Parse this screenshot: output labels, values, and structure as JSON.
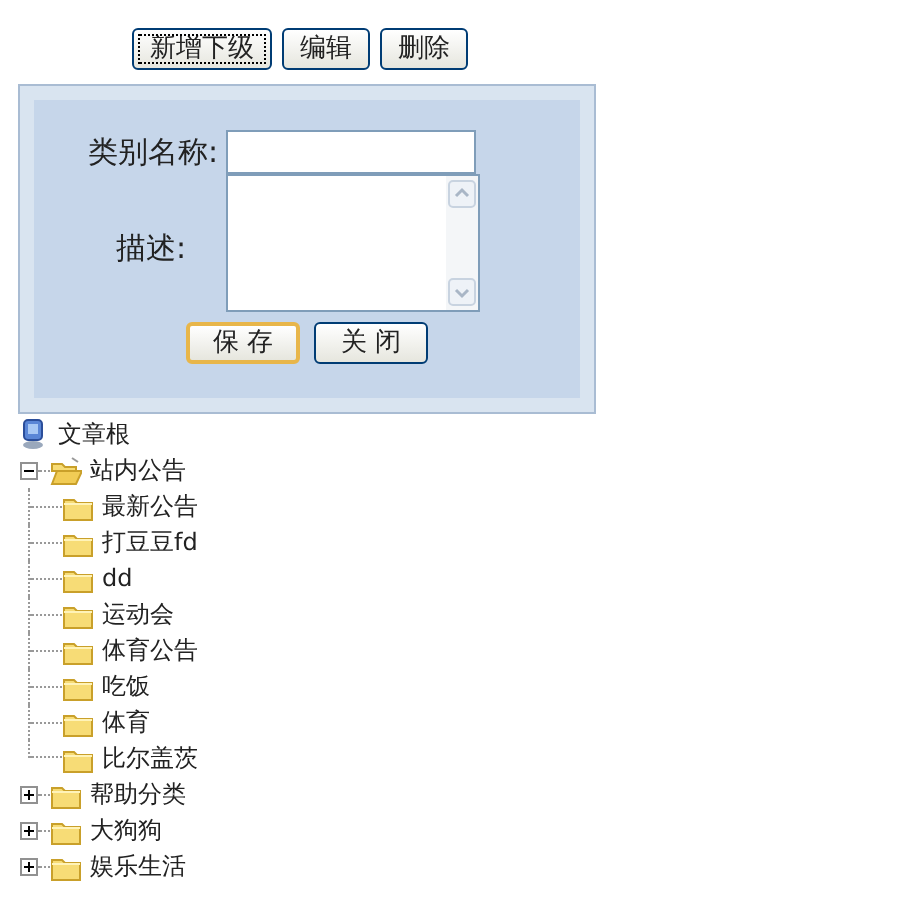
{
  "toolbar": [
    {
      "label": "新增下级",
      "focused": true
    },
    {
      "label": "编辑",
      "focused": false
    },
    {
      "label": "删除",
      "focused": false
    }
  ],
  "form": {
    "name_label": "类别名称:",
    "description_label": "描述:",
    "buttons": [
      {
        "label": "保 存",
        "default": true
      },
      {
        "label": "关 闭",
        "default": false
      }
    ]
  },
  "tree": {
    "label": "文章根",
    "children": [
      {
        "label": "站内公告",
        "expanded": true,
        "children": [
          {
            "label": "最新公告"
          },
          {
            "label": "打豆豆fd"
          },
          {
            "label": "dd"
          },
          {
            "label": "运动会"
          },
          {
            "label": "体育公告"
          },
          {
            "label": "吃饭"
          },
          {
            "label": "体育"
          },
          {
            "label": "比尔盖茨"
          }
        ]
      },
      {
        "label": "帮助分类",
        "expanded": false
      },
      {
        "label": "大狗狗",
        "expanded": false
      },
      {
        "label": "娱乐生活",
        "expanded": false
      }
    ]
  }
}
